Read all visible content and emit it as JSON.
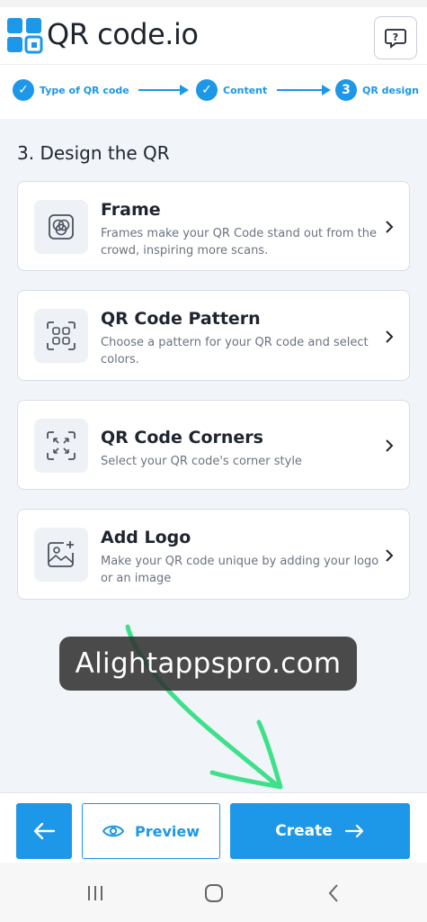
{
  "header": {
    "logo_text": "QR code.io",
    "help_icon": "question-bubble-icon"
  },
  "stepper": {
    "steps": [
      {
        "label": "Type of QR code",
        "status": "done",
        "marker": "✓"
      },
      {
        "label": "Content",
        "status": "done",
        "marker": "✓"
      },
      {
        "label": "QR design",
        "status": "current",
        "marker": "3"
      }
    ]
  },
  "section": {
    "title": "3. Design the QR"
  },
  "options": [
    {
      "title": "Frame",
      "desc": "Frames make your QR Code stand out from the crowd, inspiring more scans.",
      "icon": "frame-icon"
    },
    {
      "title": "QR Code Pattern",
      "desc": "Choose a pattern for your QR code and select colors.",
      "icon": "pattern-icon"
    },
    {
      "title": "QR Code Corners",
      "desc": "Select your QR code's corner style",
      "icon": "corners-icon"
    },
    {
      "title": "Add Logo",
      "desc": "Make your QR code unique by adding your logo or an image",
      "icon": "image-add-icon"
    }
  ],
  "watermark": {
    "text": "Alightappspro.com"
  },
  "footer": {
    "back_icon": "arrow-left-icon",
    "preview_label": "Preview",
    "create_label": "Create"
  },
  "colors": {
    "accent": "#1d97e8",
    "text": "#1f2530",
    "muted": "#6b7380",
    "background": "#f1f5f9"
  }
}
